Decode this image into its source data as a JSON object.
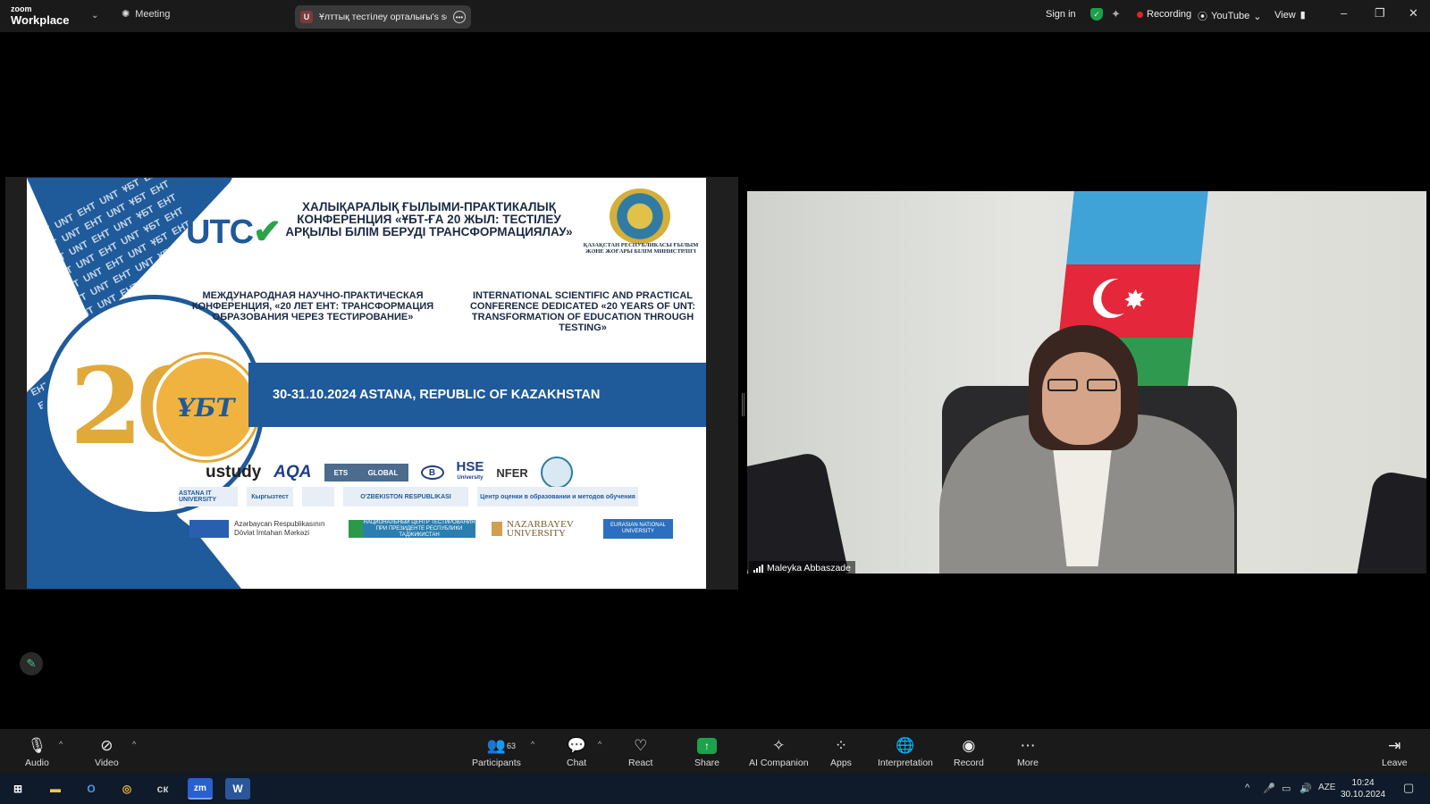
{
  "app": {
    "logo_top": "zoom",
    "logo_bottom": "Workplace",
    "meeting_label": "Meeting",
    "share_badge": "U",
    "share_title": "Ұлттық тестілеу орталығы's scr",
    "sign_in": "Sign in",
    "recording_label": "Recording",
    "youtube_label": "YouTube",
    "view_label": "View",
    "window_controls": [
      "–",
      "❐",
      "✕"
    ]
  },
  "slide": {
    "pattern_text": "EHT  UNT  ҰБТ  EHT  UNT",
    "logo_main": "UTC",
    "title_kz": "ХАЛЫҚАРАЛЫҚ ҒЫЛЫМИ-ПРАКТИКАЛЫҚ КОНФЕРЕНЦИЯ «ҰБТ-ҒА 20 ЖЫЛ: ТЕСТІЛЕУ АРҚЫЛЫ БІЛІМ БЕРУДІ ТРАНСФОРМАЦИЯЛАУ»",
    "ministry": "ҚАЗАҚСТАН РЕСПУБЛИКАСЫ ҒЫЛЫМ ЖӘНЕ ЖОҒАРЫ БІЛІМ МИНИСТРЛІГІ",
    "title_ru": "МЕЖДУНАРОДНАЯ НАУЧНО-ПРАКТИЧЕСКАЯ КОНФЕРЕНЦИЯ, «20 ЛЕТ ЕНТ: ТРАНСФОРМАЦИЯ ОБРАЗОВАНИЯ ЧЕРЕЗ ТЕСТИРОВАНИЕ»",
    "title_en": "INTERNATIONAL SCIENTIFIC AND PRACTICAL CONFERENCE DEDICATED «20 YEARS OF UNT: TRANSFORMATION OF EDUCATION THROUGH TESTING»",
    "big_number": "20",
    "circle_label": "ҰБТ",
    "date_place": "30-31.10.2024 ASTANA, REPUBLIC OF KAZAKHSTAN",
    "logos_row1": {
      "ustudy": "ustudy",
      "aqa": "AQA",
      "ets_left": "ETS",
      "ets_right": "GLOBAL",
      "b": "B",
      "hse": "HSE",
      "hse_sub": "University",
      "nfer": "NFER"
    },
    "logos_row2": {
      "astana_it": "ASTANA IT UNIVERSITY",
      "kyrgyztest": "Кыргызтест",
      "uzbek": "O'ZBEKISTON RESPUBLIKASI",
      "center": "Центр оценки в образовании и методов обучения"
    },
    "logos_row3": {
      "az_center": "Azərbaycan Respublikasının Dövlət İmtahan Mərkəzi",
      "tajik": "НАЦИОНАЛЬНЫЙ ЦЕНТР ТЕСТИРОВАНИЯ ПРИ ПРЕЗИДЕНТЕ РЕСПУБЛИКИ ТАДЖИКИСТАН",
      "nazarbayev": "NAZARBAYEV UNIVERSITY",
      "enu": "EURASIAN NATIONAL UNIVERSITY"
    }
  },
  "video": {
    "participant_name": "Maleyka Abbaszade"
  },
  "toolbar": {
    "audio": "Audio",
    "video": "Video",
    "participants": "Participants",
    "participants_count": "63",
    "chat": "Chat",
    "react": "React",
    "share": "Share",
    "ai_companion": "AI Companion",
    "apps": "Apps",
    "interpretation": "Interpretation",
    "record": "Record",
    "more": "More",
    "leave": "Leave"
  },
  "taskbar": {
    "apps": [
      "start",
      "file-explorer",
      "outlook",
      "chrome",
      "ск",
      "zoom",
      "word"
    ],
    "zoom_label": "zm",
    "word_label": "W",
    "outlook_label": "O",
    "ck_label": "ск",
    "language": "AZE",
    "time": "10:24",
    "date": "30.10.2024"
  },
  "colors": {
    "accent_blue": "#1f5a9a",
    "gold": "#e1a93a",
    "recording_red": "#e02424",
    "share_green": "#1aa34a"
  }
}
